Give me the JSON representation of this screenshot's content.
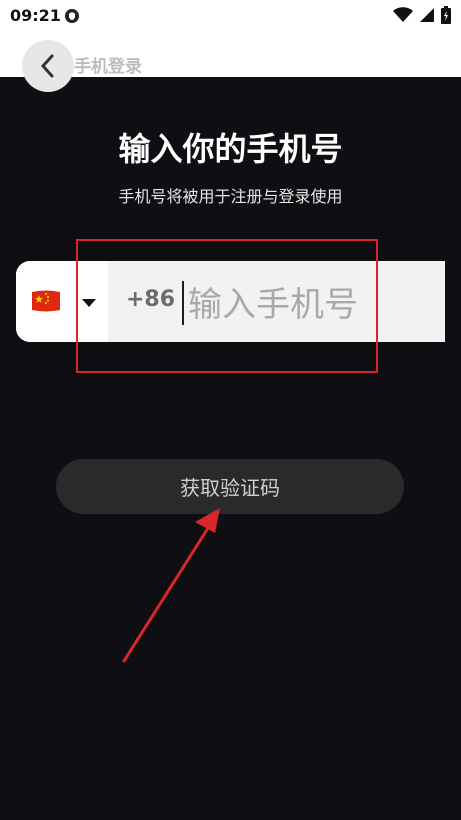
{
  "status_bar": {
    "time": "09:21"
  },
  "header": {
    "title": "手机登录"
  },
  "main": {
    "heading": "输入你的手机号",
    "subheading": "手机号将被用于注册与登录使用",
    "country_code": "+86",
    "phone_placeholder": "输入手机号",
    "get_code_label": "获取验证码"
  },
  "colors": {
    "background": "#0f0e12",
    "annotation": "#d9262b"
  }
}
